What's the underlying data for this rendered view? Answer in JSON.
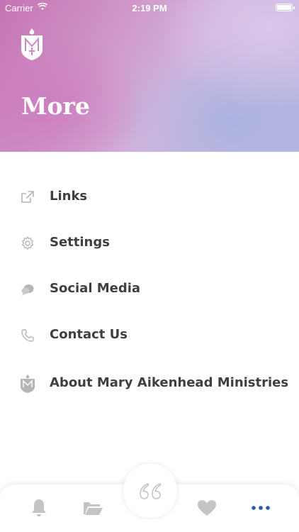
{
  "status_bar": {
    "carrier": "Carrier",
    "time": "2:19 PM",
    "battery_level": 1.0
  },
  "header": {
    "title": "More"
  },
  "menu": {
    "items": [
      {
        "label": "Links",
        "icon": "external-link-icon"
      },
      {
        "label": "Settings",
        "icon": "gear-icon"
      },
      {
        "label": "Social Media",
        "icon": "chat-bubbles-icon"
      },
      {
        "label": "Contact Us",
        "icon": "phone-icon"
      },
      {
        "label": "About Mary Aikenhead Ministries",
        "icon": "crest-icon"
      }
    ]
  },
  "tab_bar": {
    "tabs": [
      {
        "icon": "bell-icon",
        "active": false
      },
      {
        "icon": "folder-icon",
        "active": false
      },
      {
        "icon": "quote-icon",
        "active": false
      },
      {
        "icon": "heart-icon",
        "active": false
      },
      {
        "icon": "more-dots-icon",
        "active": true
      }
    ],
    "active_color": "#2e5aa6",
    "inactive_color": "#c4c4c4"
  },
  "colors": {
    "header_gradient": [
      "#c673b4",
      "#b7b6e0"
    ],
    "icon_gray": "#b5b5b5"
  }
}
